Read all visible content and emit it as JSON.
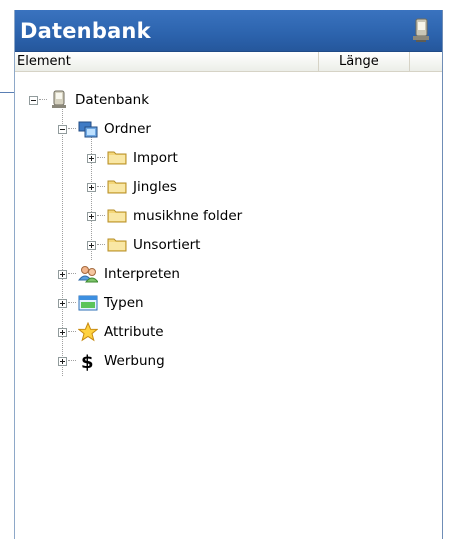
{
  "panel": {
    "title": "Datenbank",
    "title_icon": "computer-icon"
  },
  "columns": {
    "element": "Element",
    "length": "Länge"
  },
  "tree": {
    "root": {
      "label": "Datenbank",
      "icon": "computer-icon",
      "expanded": true
    },
    "ordner": {
      "label": "Ordner",
      "icon": "folder-tree-icon",
      "expanded": true
    },
    "import": {
      "label": "Import",
      "icon": "folder-icon",
      "expanded": false
    },
    "jingles": {
      "label": "Jingles",
      "icon": "folder-icon",
      "expanded": false
    },
    "musikhne": {
      "label": "musikhne folder",
      "icon": "folder-icon",
      "expanded": false
    },
    "unsortiert": {
      "label": "Unsortiert",
      "icon": "folder-icon",
      "expanded": false
    },
    "interpreten": {
      "label": "Interpreten",
      "icon": "people-icon",
      "expanded": false
    },
    "typen": {
      "label": "Typen",
      "icon": "window-icon",
      "expanded": false
    },
    "attribute": {
      "label": "Attribute",
      "icon": "star-icon",
      "expanded": false
    },
    "werbung": {
      "label": "Werbung",
      "icon": "dollar-icon",
      "expanded": false
    }
  },
  "colors": {
    "title_bar": "#2c63ad",
    "title_text": "#ffffff",
    "folder": "#f4d77a"
  }
}
